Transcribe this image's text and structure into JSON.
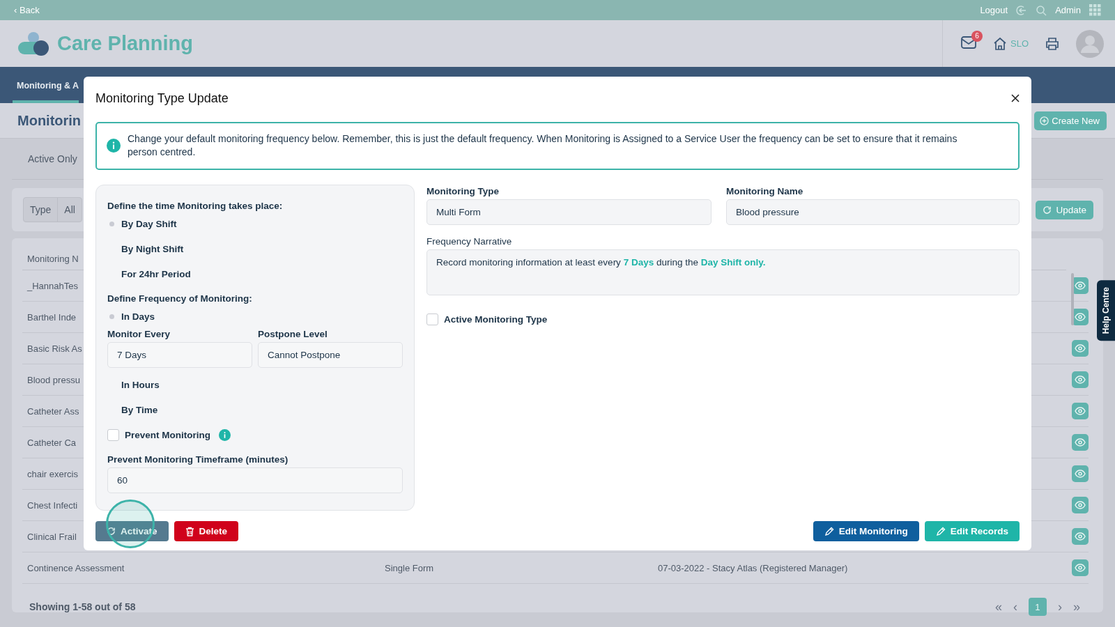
{
  "topbar": {
    "back": "‹ Back",
    "logout": "Logout",
    "admin": "Admin"
  },
  "header": {
    "app_title": "Care Planning",
    "mail_badge": "6",
    "home_label": "SLO"
  },
  "nav": {
    "tabs": [
      {
        "label": "Monitoring & A",
        "selected": true
      }
    ]
  },
  "page": {
    "title": "Monitorin",
    "create_button": "Create New",
    "filter": "Active Only",
    "type_label": "Type",
    "type_value": "All",
    "update_button": "Update"
  },
  "table": {
    "columns": [
      "Monitoring N"
    ],
    "rows": [
      {
        "cells": [
          "_HannahTes"
        ]
      },
      {
        "cells": [
          "Barthel Inde"
        ]
      },
      {
        "cells": [
          "Basic Risk As"
        ]
      },
      {
        "cells": [
          "Blood pressu"
        ]
      },
      {
        "cells": [
          "Catheter Ass"
        ]
      },
      {
        "cells": [
          "Catheter Ca"
        ]
      },
      {
        "cells": [
          "chair exercis"
        ]
      },
      {
        "cells": [
          "Chest Infecti"
        ]
      },
      {
        "cells": [
          "Clinical Frail"
        ]
      },
      {
        "cells": [
          "Continence Assessment",
          "Single Form",
          "07-03-2022 - Stacy Atlas (Registered Manager)"
        ]
      }
    ]
  },
  "footer": {
    "showing": "Showing 1-58 out of 58",
    "first": "«",
    "previous": "‹",
    "pages": [
      {
        "label": "1",
        "selected": true
      }
    ],
    "next": "›",
    "last": "»"
  },
  "help_tab": "Help Centre",
  "modal": {
    "title": "Monitoring Type Update",
    "info": "Change your default monitoring frequency below. Remember, this is just the default frequency. When Monitoring is Assigned to a Service User the frequency can be set to ensure that it remains person centred.",
    "time": {
      "heading": "Define the time Monitoring takes place:",
      "options": [
        {
          "label": "By Day Shift",
          "selected": true
        },
        {
          "label": "By Night Shift",
          "selected": false
        },
        {
          "label": "For 24hr Period",
          "selected": false
        }
      ]
    },
    "frequency": {
      "heading": "Define Frequency of Monitoring:",
      "options": [
        {
          "label": "In Days",
          "selected": true,
          "fields": [
            {
              "label": "Monitor Every",
              "value": "7 Days"
            },
            {
              "label": "Postpone Level",
              "value": "Cannot Postpone"
            }
          ]
        },
        {
          "label": "In Hours",
          "selected": false
        },
        {
          "label": "By Time",
          "selected": false
        }
      ]
    },
    "prevent": {
      "label": "Prevent Monitoring",
      "checked": false
    },
    "timeframe": {
      "label": "Prevent Monitoring Timeframe (minutes)",
      "value": "60"
    },
    "fields": [
      {
        "label": "Monitoring Type",
        "value": "Multi Form"
      },
      {
        "label": "Monitoring Name",
        "value": "Blood pressure"
      }
    ],
    "narrative": {
      "label": "Frequency Narrative",
      "text": "Record monitoring information at least every **7 Days** during the **Day Shift only.**"
    },
    "active": {
      "label": "Active Monitoring Type",
      "checked": false
    },
    "buttons": [
      {
        "label": "Activate",
        "kind": "activate"
      },
      {
        "label": "Delete",
        "kind": "delete"
      },
      {
        "label": "Edit Monitoring",
        "kind": "edit-monitoring"
      },
      {
        "label": "Edit Records",
        "kind": "edit-records"
      }
    ]
  }
}
